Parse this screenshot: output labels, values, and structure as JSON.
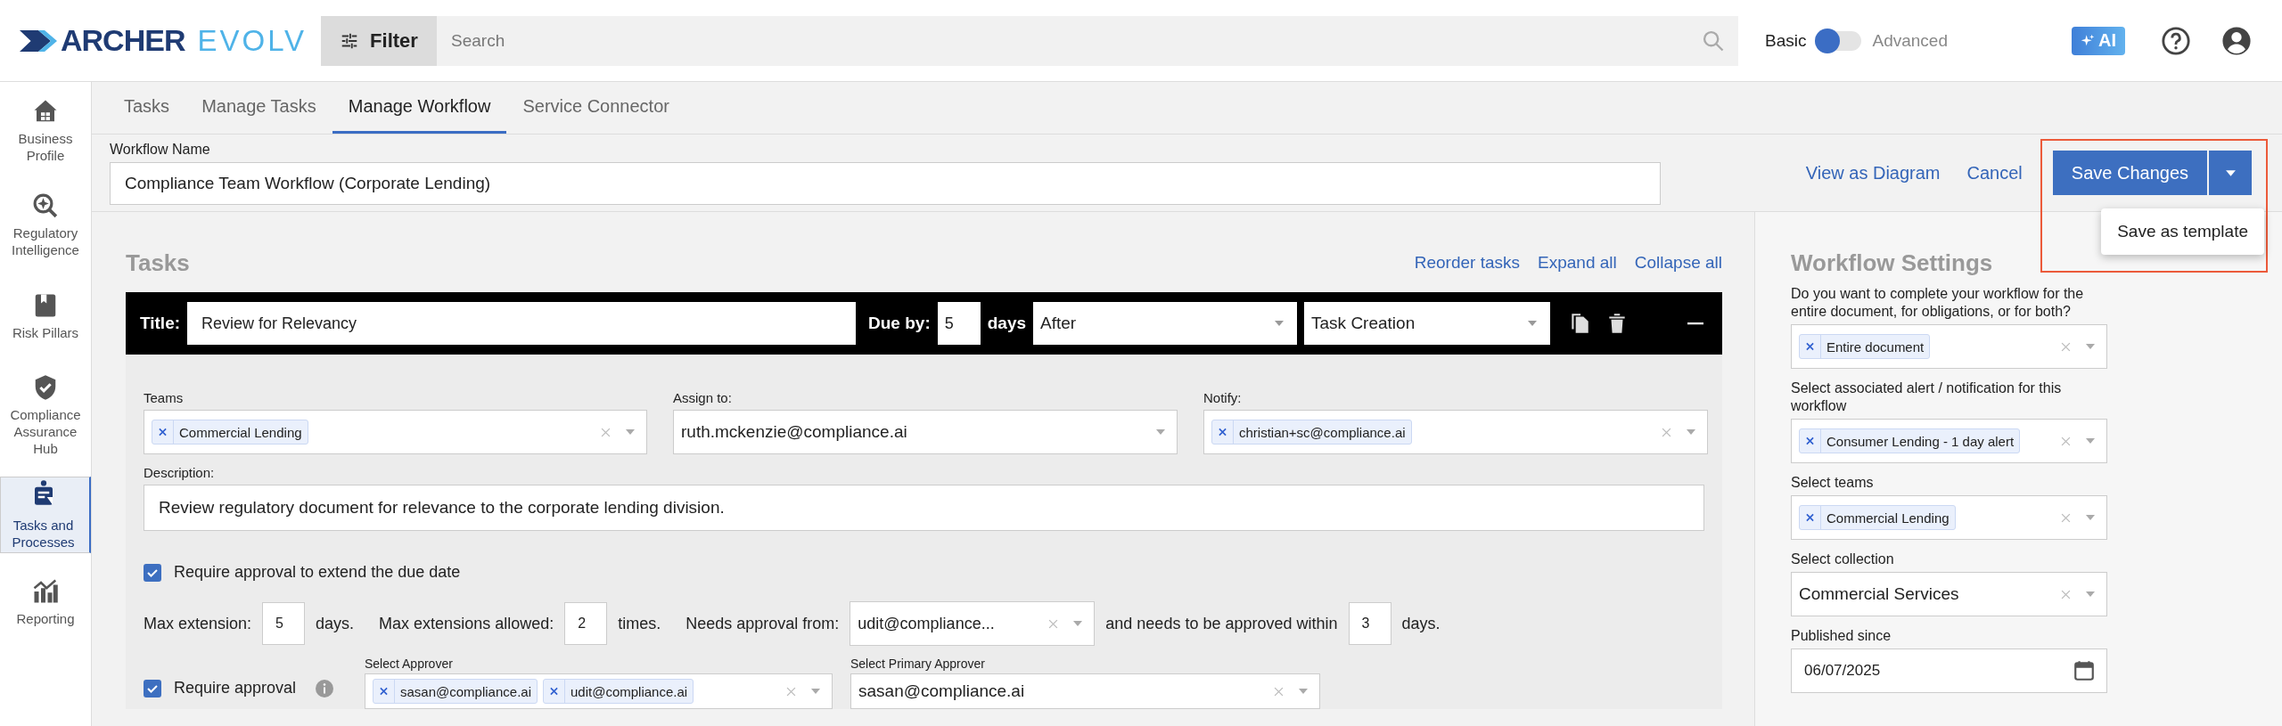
{
  "header": {
    "logo_left": "ARCHER",
    "logo_right": "EVOLV",
    "filter_label": "Filter",
    "search": {
      "placeholder": "Search"
    },
    "mode_toggle": {
      "left": "Basic",
      "right": "Advanced",
      "on": false
    },
    "ai_label": "AI"
  },
  "sidebar": {
    "items": [
      {
        "label": "Business Profile",
        "kind": "house",
        "selected": false
      },
      {
        "label": "Regulatory Intelligence",
        "kind": "magnifier",
        "selected": false
      },
      {
        "label": "Risk Pillars",
        "kind": "bookmark",
        "selected": false
      },
      {
        "label": "Compliance Assurance Hub",
        "kind": "shield",
        "selected": false
      },
      {
        "label": "Tasks and Processes",
        "kind": "clipboard",
        "selected": true
      },
      {
        "label": "Reporting",
        "kind": "chart",
        "selected": false
      }
    ]
  },
  "tabs": [
    {
      "label": "Tasks",
      "selected": false
    },
    {
      "label": "Manage Tasks",
      "selected": false
    },
    {
      "label": "Manage Workflow",
      "selected": true
    },
    {
      "label": "Service Connector",
      "selected": false
    }
  ],
  "workflow_name": {
    "label": "Workflow Name",
    "value": "Compliance Team Workflow (Corporate Lending)"
  },
  "actions": {
    "view_diagram": "View as Diagram",
    "cancel": "Cancel",
    "save": "Save Changes",
    "menu": [
      "Save as template"
    ]
  },
  "tasks": {
    "heading": "Tasks",
    "links": [
      "Reorder tasks",
      "Expand all",
      "Collapse all"
    ],
    "task": {
      "title_label": "Title:",
      "title": "Review for Relevancy",
      "due_label": "Due by:",
      "due_value": "5",
      "days_label": "days",
      "relation": "After",
      "event": "Task Creation",
      "teams": {
        "label": "Teams",
        "tags": [
          "Commercial Lending"
        ]
      },
      "assign": {
        "label": "Assign to:",
        "value": "ruth.mckenzie@compliance.ai"
      },
      "notify": {
        "label": "Notify:",
        "tags": [
          "christian+sc@compliance.ai"
        ]
      },
      "description": {
        "label": "Description:",
        "value": "Review regulatory document for relevance to the corporate lending division."
      },
      "extend_approval": {
        "label": "Require approval to extend the due date",
        "checked": true
      },
      "extension": {
        "max_label": "Max extension:",
        "max_value": "5",
        "max_unit": "days.",
        "allowed_label": "Max extensions allowed:",
        "allowed_value": "2",
        "allowed_unit": "times.",
        "from_label": "Needs approval from:",
        "from_value": "udit@compliance...",
        "within_label": "and needs to be approved within",
        "within_value": "3",
        "within_unit": "days."
      },
      "approval": {
        "label": "Require approval",
        "checked": true,
        "approver_label": "Select Approver",
        "approvers": [
          "sasan@compliance.ai",
          "udit@compliance.ai"
        ],
        "primary_label": "Select Primary Approver",
        "primary": "sasan@compliance.ai"
      }
    }
  },
  "settings": {
    "heading": "Workflow Settings",
    "fields": [
      {
        "kind": "tags",
        "label": "Do you want to complete your workflow for the entire document, for obligations, or for both?",
        "tags": [
          "Entire document"
        ]
      },
      {
        "kind": "tags",
        "label": "Select associated alert / notification for this workflow",
        "tags": [
          "Consumer Lending - 1 day alert"
        ]
      },
      {
        "kind": "tags",
        "label": "Select teams",
        "tags": [
          "Commercial Lending"
        ]
      },
      {
        "kind": "single",
        "label": "Select collection",
        "value": "Commercial Services"
      },
      {
        "kind": "date",
        "label": "Published since",
        "value": "06/07/2025"
      }
    ]
  }
}
